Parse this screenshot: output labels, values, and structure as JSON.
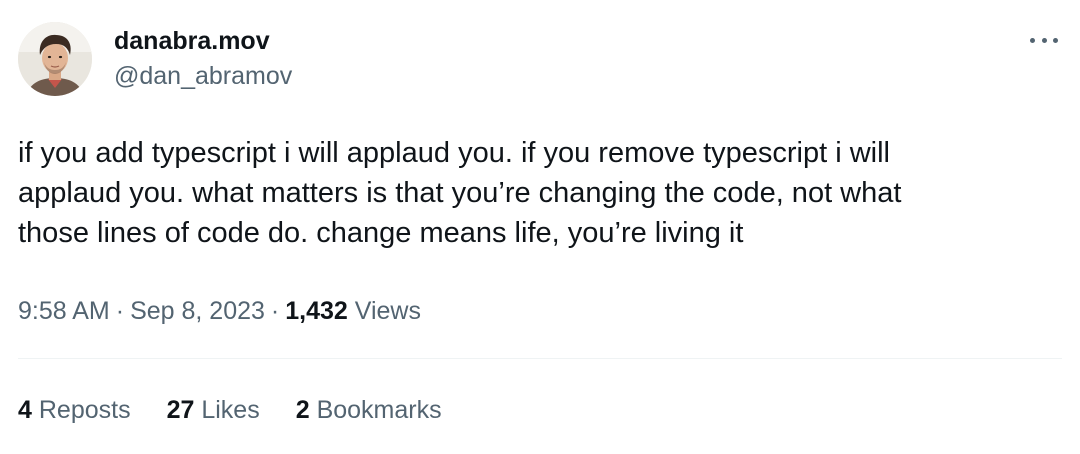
{
  "author": {
    "display_name": "danabra.mov",
    "handle": "@dan_abramov",
    "avatar_icon": "avatar-photo"
  },
  "tweet": {
    "text": "if you add typescript i will applaud you. if you remove typescript i will\napplaud you. what matters is that you’re changing the code, not what\nthose lines of code do. change means life, you’re living it"
  },
  "meta": {
    "time": "9:58 AM",
    "separator": "·",
    "date": "Sep 8, 2023",
    "views_count": "1,432",
    "views_label": "Views"
  },
  "stats": {
    "reposts": {
      "count": "4",
      "label": "Reposts"
    },
    "likes": {
      "count": "27",
      "label": "Likes"
    },
    "bookmarks": {
      "count": "2",
      "label": "Bookmarks"
    }
  },
  "icons": {
    "more": "more-horizontal-icon"
  },
  "colors": {
    "text_primary": "#0f1419",
    "text_secondary": "#536471",
    "divider": "#eff3f4"
  }
}
